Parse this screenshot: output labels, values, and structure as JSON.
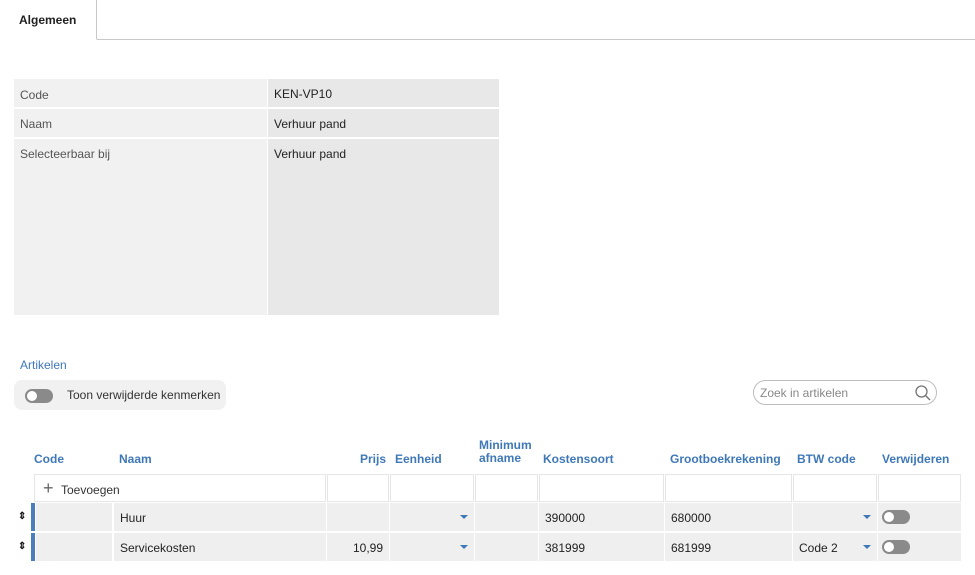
{
  "tabs": [
    {
      "label": "Algemeen"
    }
  ],
  "form": {
    "code_label": "Code",
    "code_value": "KEN-VP10",
    "naam_label": "Naam",
    "naam_value": "Verhuur pand",
    "select_label": "Selecteerbaar bij",
    "select_value": "Verhuur pand"
  },
  "articles": {
    "title": "Artikelen",
    "toggle_label": "Toon verwijderde kenmerken",
    "search_placeholder": "Zoek in artikelen",
    "columns": {
      "code": "Code",
      "naam": "Naam",
      "prijs": "Prijs",
      "eenheid": "Eenheid",
      "min1": "Minimum",
      "min2": "afname",
      "kostensoort": "Kostensoort",
      "grootboek": "Grootboekrekening",
      "btw": "BTW code",
      "verwijderen": "Verwijderen"
    },
    "add_label": "Toevoegen",
    "rows": [
      {
        "code": "",
        "naam": "Huur",
        "prijs": "",
        "eenheid": "",
        "minimum": "",
        "kostensoort": "390000",
        "grootboek": "680000",
        "btw": "",
        "verwijderen": false
      },
      {
        "code": "",
        "naam": "Servicekosten",
        "prijs": "10,99",
        "eenheid": "",
        "minimum": "",
        "kostensoort": "381999",
        "grootboek": "681999",
        "btw": "Code 2",
        "verwijderen": false
      }
    ]
  },
  "colors": {
    "accent": "#3f78b7",
    "marker": "#4a7ebd"
  },
  "icons": [
    "search-icon",
    "plus-icon",
    "drag-handle-icon",
    "dropdown-caret-icon"
  ]
}
